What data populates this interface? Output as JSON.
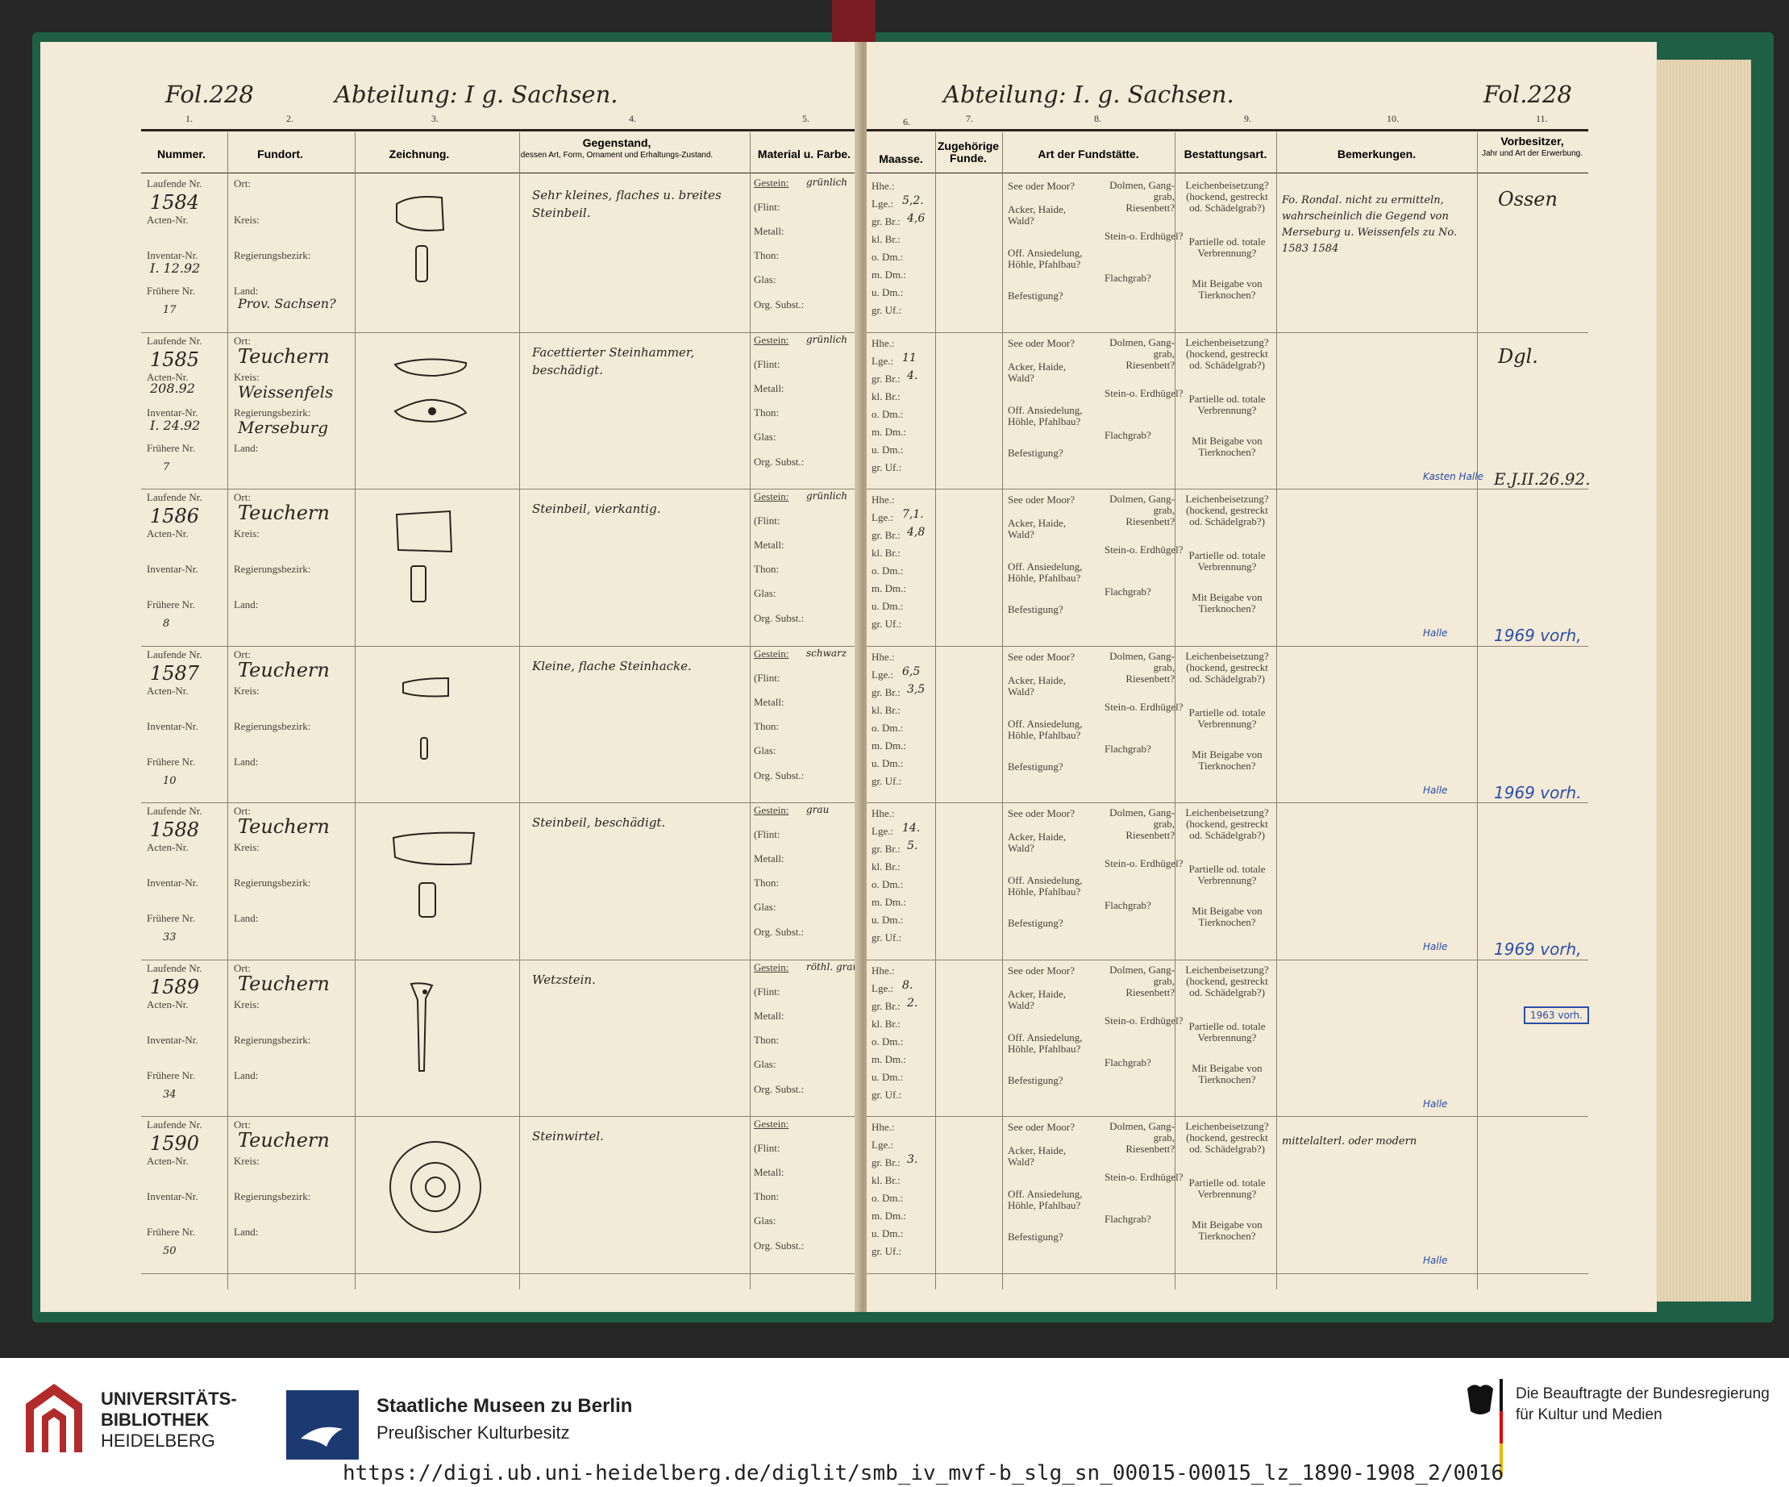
{
  "header": {
    "left_fol": "Fol.228",
    "right_fol": "Fol.228",
    "left_abteilung": "Abteilung: I g. Sachsen.",
    "right_abteilung": "Abteilung: I. g. Sachsen."
  },
  "column_numbers": [
    "1.",
    "2.",
    "3.",
    "4.",
    "5.",
    "6.",
    "7.",
    "8.",
    "9.",
    "10.",
    "11."
  ],
  "columns": {
    "nummer": "Nummer.",
    "fundort": "Fundort.",
    "zeichnung": "Zeichnung.",
    "gegenstand": "Gegenstand,",
    "gegenstand_sub": "dessen Art, Form, Ornament und Erhaltungs-Zustand.",
    "material": "Material u. Farbe.",
    "maasse": "Maasse.",
    "zugehoerige": "Zugehörige Funde.",
    "fundstaette": "Art der Fundstätte.",
    "bestattung": "Bestattungsart.",
    "bemerkungen": "Bemerkungen.",
    "vorbesitzer": "Vorbesitzer,",
    "vorbesitzer_sub": "Jahr und Art der Erwerbung."
  },
  "labels": {
    "laufende": "Laufende Nr.",
    "acten": "Acten-Nr.",
    "inventar": "Inventar-Nr.",
    "fruehere": "Frühere Nr.",
    "ort": "Ort:",
    "kreis": "Kreis:",
    "regbez": "Regierungsbezirk:",
    "land": "Land:",
    "gestein": "Gestein:",
    "flint": "(Flint:",
    "metall": "Metall:",
    "thon": "Thon:",
    "glas": "Glas:",
    "org": "Org. Subst.:",
    "hhe": "Hhe.:",
    "lge": "Lge.:",
    "grbr": "gr. Br.:",
    "klbr": "kl. Br.:",
    "odm": "o. Dm.:",
    "mdm": "m. Dm.:",
    "udm": "u. Dm.:",
    "gruf": "gr. Uf.:",
    "see": "See oder Moor?",
    "acker": "Acker, Haide, Wald?",
    "off": "Off. Ansiedelung, Höhle, Pfahlbau?",
    "befest": "Befestigung?",
    "dolmen": "Dolmen, Gang- grab, Riesenbett?",
    "stein": "Stein-o. Erdhügel?",
    "flach": "Flachgrab?",
    "leichen": "Leichenbeisetzung? (hockend, gestreckt od. Schädelgrab?)",
    "partielle": "Partielle od. totale Verbrennung?",
    "beigabe": "Mit Beigabe von Tierknochen?"
  },
  "rows": [
    {
      "laufende": "1584",
      "acten": "",
      "inventar": "I. 12.92",
      "fruehere": "17",
      "ort": "",
      "kreis": "",
      "regbez": "",
      "land": "Prov. Sachsen?",
      "gegenstand": "Sehr kleines, flaches u. breites Steinbeil.",
      "gestein": "grünlich",
      "lge": "5,2.",
      "grbr": "4,6",
      "bem": "Fo. Rondal. nicht zu ermitteln, wahrscheinlich die Gegend von Merseburg u. Weissenfels zu No. 1583 1584",
      "vorb": "Ossen",
      "note": "",
      "blue": ""
    },
    {
      "laufende": "1585",
      "acten": "208.92",
      "inventar": "I. 24.92",
      "fruehere": "7",
      "ort": "Teuchern",
      "kreis": "Weissenfels",
      "regbez": "Merseburg",
      "land": "",
      "gegenstand": "Facettierter Steinhammer, beschädigt.",
      "gestein": "grünlich",
      "lge": "11",
      "grbr": "4.",
      "bem": "",
      "vorb": "Dgl.",
      "note": "Kasten Halle",
      "blue": "E.J.II.26.92."
    },
    {
      "laufende": "1586",
      "acten": "",
      "inventar": "",
      "fruehere": "8",
      "ort": "Teuchern",
      "kreis": "",
      "regbez": "",
      "land": "",
      "gegenstand": "Steinbeil, vierkantig.",
      "gestein": "grünlich",
      "lge": "7,1.",
      "grbr": "4,8",
      "bem": "",
      "vorb": "",
      "note": "Halle",
      "blue": "1969 vorh,"
    },
    {
      "laufende": "1587",
      "acten": "",
      "inventar": "",
      "fruehere": "10",
      "ort": "Teuchern",
      "kreis": "",
      "regbez": "",
      "land": "",
      "gegenstand": "Kleine, flache Steinhacke.",
      "gestein": "schwarz",
      "lge": "6,5",
      "grbr": "3,5",
      "bem": "",
      "vorb": "",
      "note": "Halle",
      "blue": "1969 vorh."
    },
    {
      "laufende": "1588",
      "acten": "",
      "inventar": "",
      "fruehere": "33",
      "ort": "Teuchern",
      "kreis": "",
      "regbez": "",
      "land": "",
      "gegenstand": "Steinbeil, beschädigt.",
      "gestein": "grau",
      "lge": "14.",
      "grbr": "5.",
      "bem": "",
      "vorb": "",
      "note": "Halle",
      "blue": "1969 vorh,"
    },
    {
      "laufende": "1589",
      "acten": "",
      "inventar": "",
      "fruehere": "34",
      "ort": "Teuchern",
      "kreis": "",
      "regbez": "",
      "land": "",
      "gegenstand": "Wetzstein.",
      "gestein": "röthl. grau",
      "lge": "8.",
      "grbr": "2.",
      "bem": "",
      "vorb": "",
      "note": "Halle",
      "blue": "",
      "stamp": "1963 vorh."
    },
    {
      "laufende": "1590",
      "acten": "",
      "inventar": "",
      "fruehere": "50",
      "ort": "Teuchern",
      "kreis": "",
      "regbez": "",
      "land": "",
      "gegenstand": "Steinwirtel.",
      "gestein": "",
      "lge": "",
      "grbr": "3.",
      "bem": "mittelalterl. oder modern",
      "vorb": "",
      "note": "Halle",
      "blue": ""
    }
  ],
  "footer": {
    "ub_line1": "UNIVERSITÄTS-",
    "ub_line2": "BIBLIOTHEK",
    "ub_line3": "HEIDELBERG",
    "smb_line1": "Staatliche Museen zu Berlin",
    "smb_line2": "Preußischer Kulturbesitz",
    "bkm_line1": "Die Beauftragte der Bundesregierung",
    "bkm_line2": "für Kultur und Medien",
    "url": "https://digi.ub.uni-heidelberg.de/diglit/smb_iv_mvf-b_slg_sn_00015-00015_lz_1890-1908_2/0016"
  },
  "colors": {
    "ink": "#2a2320",
    "blue_ink": "#2a4fa8",
    "paper": "#f3ead7",
    "cover": "#1f5f45"
  }
}
